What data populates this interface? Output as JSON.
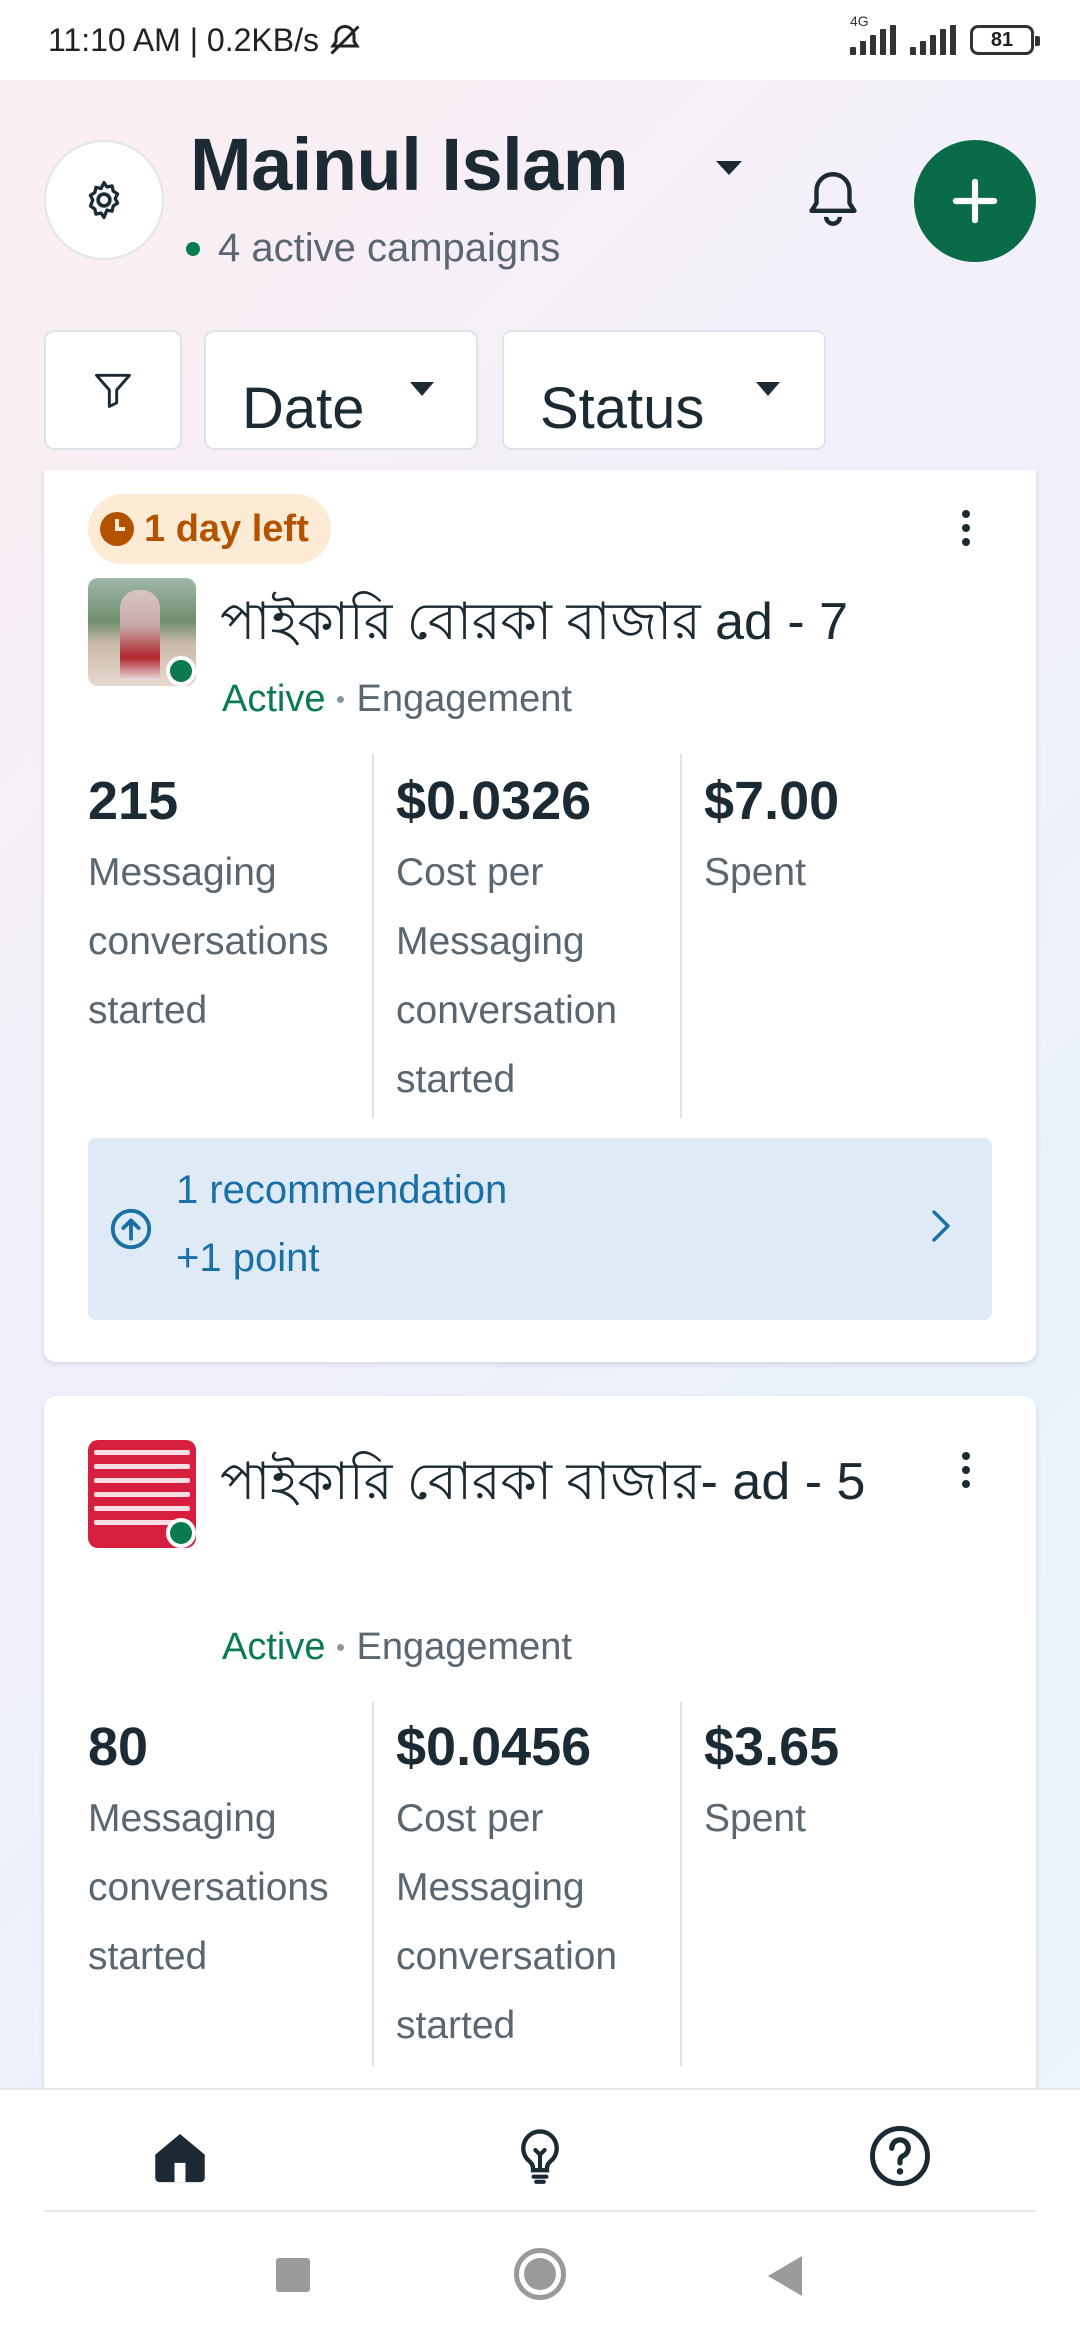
{
  "status_bar": {
    "time_speed": "11:10 AM | 0.2KB/s",
    "network_label": "4G",
    "battery": "81"
  },
  "header": {
    "account_name": "Mainul Islam",
    "campaign_summary": "4 active campaigns"
  },
  "filters": {
    "date_label": "Date",
    "status_label": "Status"
  },
  "campaigns": [
    {
      "time_left": "1 day left",
      "name": "পাইকারি বোরকা বাজার ad - 7",
      "status": "Active",
      "objective": "Engagement",
      "metrics": [
        {
          "value": "215",
          "label": "Messaging conversations started"
        },
        {
          "value": "$0.0326",
          "label": "Cost per Messaging conversation started"
        },
        {
          "value": "$7.00",
          "label": "Spent"
        }
      ],
      "recommendation": {
        "title": "1 recommendation",
        "points": "+1 point"
      }
    },
    {
      "name": "পাইকারি বোরকা বাজার- ad - 5",
      "status": "Active",
      "objective": "Engagement",
      "metrics": [
        {
          "value": "80",
          "label": "Messaging conversations started"
        },
        {
          "value": "$0.0456",
          "label": "Cost per Messaging conversation started"
        },
        {
          "value": "$3.65",
          "label": "Spent"
        }
      ]
    }
  ],
  "colors": {
    "brand_green": "#0a6b4a",
    "active_green": "#0a7a4f",
    "warning_orange": "#b35300",
    "recommendation_blue": "#1a6fa6"
  },
  "icons": {
    "settings": "gear-icon",
    "dropdown": "caret-down-icon",
    "notifications": "bell-icon",
    "create": "plus-icon",
    "filter": "funnel-icon",
    "more": "kebab-icon",
    "recommendation": "arrow-up-circle-icon",
    "chevron": "chevron-right-icon",
    "nav": [
      "home-icon",
      "lightbulb-icon",
      "help-icon"
    ]
  }
}
